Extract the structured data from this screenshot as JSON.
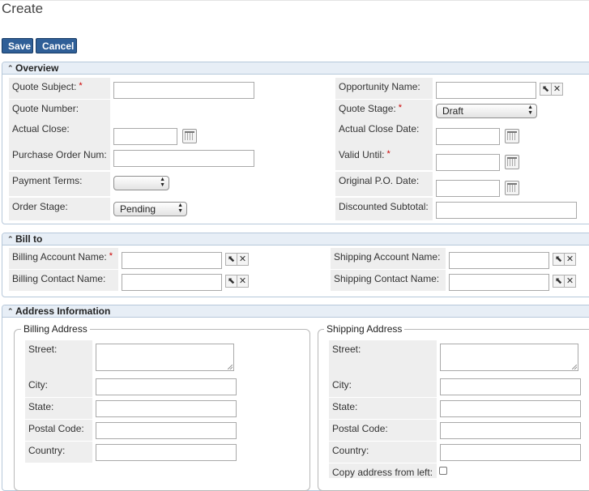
{
  "page": {
    "title": "Create"
  },
  "toolbar": {
    "save_label": "Save",
    "cancel_label": "Cancel"
  },
  "overview": {
    "title": "Overview",
    "quote_subject_label": "Quote Subject:",
    "quote_number_label": "Quote Number:",
    "actual_close_label": "Actual Close:",
    "purchase_order_num_label": "Purchase Order Num:",
    "payment_terms_label": "Payment Terms:",
    "order_stage_label": "Order Stage:",
    "order_stage_value": "Pending",
    "opportunity_name_label": "Opportunity Name:",
    "quote_stage_label": "Quote Stage:",
    "quote_stage_value": "Draft",
    "actual_close_date_label": "Actual Close Date:",
    "valid_until_label": "Valid Until:",
    "original_po_date_label": "Original P.O. Date:",
    "discounted_subtotal_label": "Discounted Subtotal:"
  },
  "bill_to": {
    "title": "Bill to",
    "billing_account_name_label": "Billing Account Name:",
    "billing_contact_name_label": "Billing Contact Name:",
    "shipping_account_name_label": "Shipping Account Name:",
    "shipping_contact_name_label": "Shipping Contact Name:"
  },
  "address": {
    "title": "Address Information",
    "billing": {
      "legend": "Billing Address",
      "street_label": "Street:",
      "city_label": "City:",
      "state_label": "State:",
      "postal_code_label": "Postal Code:",
      "country_label": "Country:"
    },
    "shipping": {
      "legend": "Shipping Address",
      "street_label": "Street:",
      "city_label": "City:",
      "state_label": "State:",
      "postal_code_label": "Postal Code:",
      "country_label": "Country:",
      "copy_label": "Copy address from left:"
    }
  },
  "symbols": {
    "required": "*",
    "pointer": "⬉",
    "clear": "✕",
    "chevron_up": "⌃"
  },
  "icons": [
    "chevron-up-icon",
    "calendar-icon",
    "select-pointer-icon",
    "clear-icon",
    "select-arrows-icon"
  ],
  "colors": {
    "button_bg": "#2f5f97",
    "panel_header_bg": "#e7eef6",
    "panel_border": "#b6c8da",
    "required": "#cc0000",
    "label_bg": "#eeeeee"
  }
}
